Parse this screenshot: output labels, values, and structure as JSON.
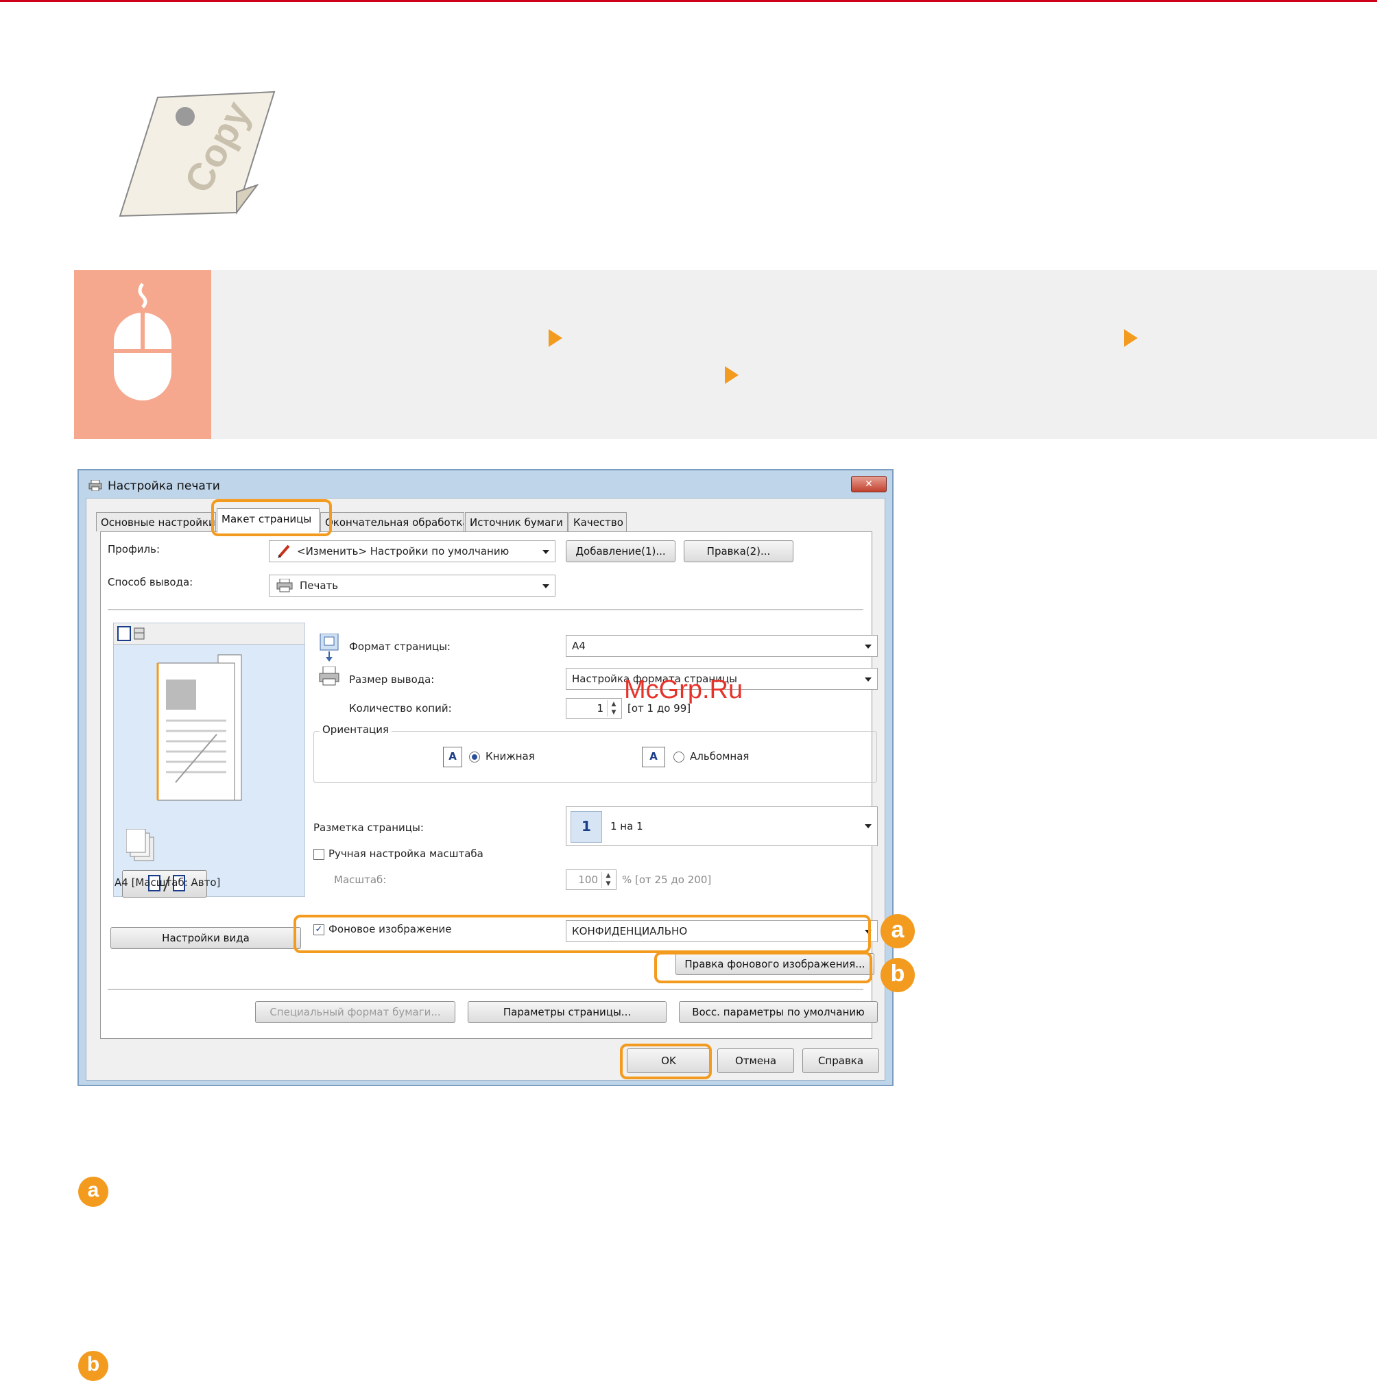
{
  "dialog": {
    "title": "Настройка печати",
    "close_glyph": "✕",
    "tabs": [
      "Основные настройки",
      "Макет страницы",
      "Окончательная обработка",
      "Источник бумаги",
      "Качество"
    ],
    "profile_label": "Профиль:",
    "profile_value": "<Изменить> Настройки по умолчанию",
    "add_button": "Добавление(1)...",
    "edit_button": "Правка(2)...",
    "output_label": "Способ вывода:",
    "output_value": "Печать",
    "page_size_label": "Формат страницы:",
    "page_size_value": "A4",
    "output_size_label": "Размер вывода:",
    "output_size_value": "Настройка формата страницы",
    "copies_label": "Количество копий:",
    "copies_value": "1",
    "copies_range": "[от 1 до 99]",
    "orientation_label": "Ориентация",
    "portrait_label": "Книжная",
    "landscape_label": "Альбомная",
    "orientation_glyph": "A",
    "page_layout_label": "Разметка страницы:",
    "page_layout_value": "1 на 1",
    "page_layout_icon": "1",
    "manual_scaling_label": "Ручная настройка масштаба",
    "scale_label": "Масштаб:",
    "scale_value": "100",
    "scale_range": "% [от 25 до 200]",
    "preview_caption": "A4 [Масштаб: Авто]",
    "view_settings_button": "Настройки вида",
    "watermark_label": "Фоновое изображение",
    "watermark_checked": "✓",
    "watermark_value": "КОНФИДЕНЦИАЛЬНО",
    "edit_watermark_button": "Правка фонового изображения...",
    "custom_paper_button": "Специальный формат бумаги...",
    "page_options_button": "Параметры страницы...",
    "restore_defaults_button": "Восс. параметры по умолчанию",
    "ok_button": "OK",
    "cancel_button": "Отмена",
    "help_button": "Справка"
  },
  "markers": {
    "a": "a",
    "b": "b"
  },
  "watermark_site": "McGrp.Ru",
  "colors": {
    "accent_orange": "#f39b1f",
    "top_line_red": "#d0001b",
    "mouse_icon_bg": "#f5a88e",
    "proc_bar_bg": "#f0f0f0"
  },
  "icons": [
    "copy-document-icon",
    "mouse-icon",
    "printer-icon",
    "pencil-icon",
    "chevron-down-icon"
  ]
}
